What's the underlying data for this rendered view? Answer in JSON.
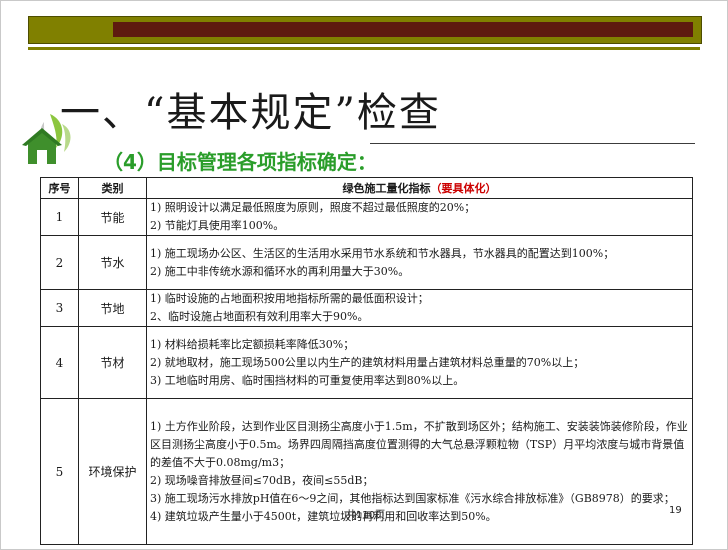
{
  "slide": {
    "title": "一、“基本规定”检查",
    "subtitle": "（4）目标管理各项指标确定："
  },
  "table": {
    "headers": {
      "no": "序号",
      "category": "类别",
      "indicator": "绿色施工量化指标",
      "indicator_note": "（要具体化）"
    },
    "rows": [
      {
        "no": "1",
        "category": "节能",
        "lines": [
          "1) 照明设计以满足最低照度为原则，照度不超过最低照度的20%；",
          "2) 节能灯具使用率100%。"
        ]
      },
      {
        "no": "2",
        "category": "节水",
        "lines": [
          "1) 施工现场办公区、生活区的生活用水采用节水系统和节水器具，节水器具的配置达到100%；",
          "2) 施工中非传统水源和循环水的再利用量大于30%。"
        ]
      },
      {
        "no": "3",
        "category": "节地",
        "lines": [
          "1) 临时设施的占地面积按用地指标所需的最低面积设计；",
          "2、临时设施占地面积有效利用率大于90%。"
        ]
      },
      {
        "no": "4",
        "category": "节材",
        "lines": [
          "1) 材料给损耗率比定额损耗率降低30%；",
          "2) 就地取材，施工现场500公里以内生产的建筑材料用量占建筑材料总重量的70%以上；",
          "3) 工地临时用房、临时围挡材料的可重复使用率达到80%以上。"
        ]
      },
      {
        "no": "5",
        "category": "环境保护",
        "lines": [
          "1) 土方作业阶段，达到作业区目测扬尘高度小于1.5m，不扩散到场区外；结构施工、安装装饰装修阶段，作业区目测扬尘高度小于0.5m。场界四周隔挡高度位置测得的大气总悬浮颗粒物（TSP）月平均浓度与城市背景值的差值不大于0.08mg/m3；",
          "2) 现场噪音排放昼间≤70dB，夜间≤55dB；",
          "3) 施工现场污水排放pH值在6～9之间，其他指标达到国家标准《污水综合排放标准》（GB8978）的要求；",
          "4) 建筑垃圾产生量小于4500t，建筑垃圾的再利用和回收率达到50%。"
        ]
      }
    ]
  },
  "footer": {
    "total_pages": "共110页",
    "page_number": "19"
  },
  "colors": {
    "band": "#808000",
    "band_inner": "#5e1a0f",
    "subtitle": "#2a9d2a",
    "emphasis": "#cc0000"
  },
  "icons": {
    "logo": "green-house-leaf-logo"
  }
}
